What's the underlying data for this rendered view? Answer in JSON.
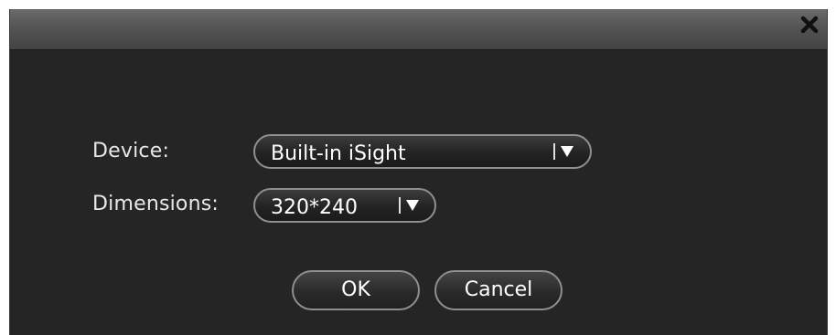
{
  "dialog": {
    "close_icon": "close-icon",
    "device": {
      "label": "Device:",
      "selected": "Built-in iSight"
    },
    "dimensions": {
      "label": "Dimensions:",
      "selected": "320*240"
    },
    "buttons": {
      "ok": "OK",
      "cancel": "Cancel"
    }
  },
  "colors": {
    "dialog_background": "#252525",
    "titlebar": "#545454",
    "control_border": "#8f8f8f",
    "text": "#ffffff"
  }
}
